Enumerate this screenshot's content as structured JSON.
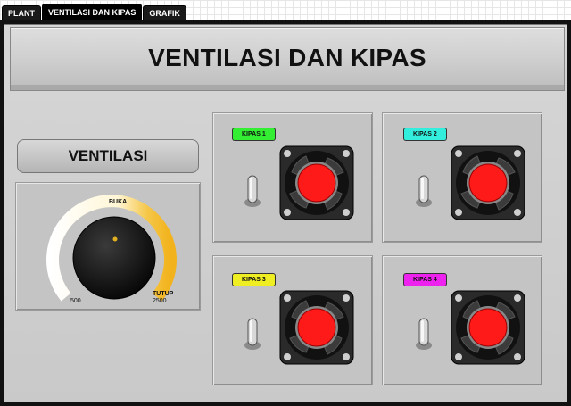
{
  "tabs": [
    {
      "label": "PLANT",
      "active": false
    },
    {
      "label": "VENTILASI DAN KIPAS",
      "active": true
    },
    {
      "label": "GRAFIK",
      "active": false
    }
  ],
  "header": {
    "title": "VENTILASI DAN KIPAS"
  },
  "ventilasi": {
    "title": "VENTILASI",
    "knob": {
      "label_open": "BUKA",
      "label_close": "TUTUP",
      "scale_min": "500",
      "scale_max": "2500"
    }
  },
  "fans": [
    {
      "label": "KIPAS 1",
      "color": "#33ee33"
    },
    {
      "label": "KIPAS 2",
      "color": "#33eedd"
    },
    {
      "label": "KIPAS 3",
      "color": "#eeee22"
    },
    {
      "label": "KIPAS 4",
      "color": "#ee22ee"
    }
  ],
  "colors": {
    "fan_hub": "#ff1a1a",
    "gauge_arc": "#f2c12e",
    "background": "#c9c9c9"
  }
}
